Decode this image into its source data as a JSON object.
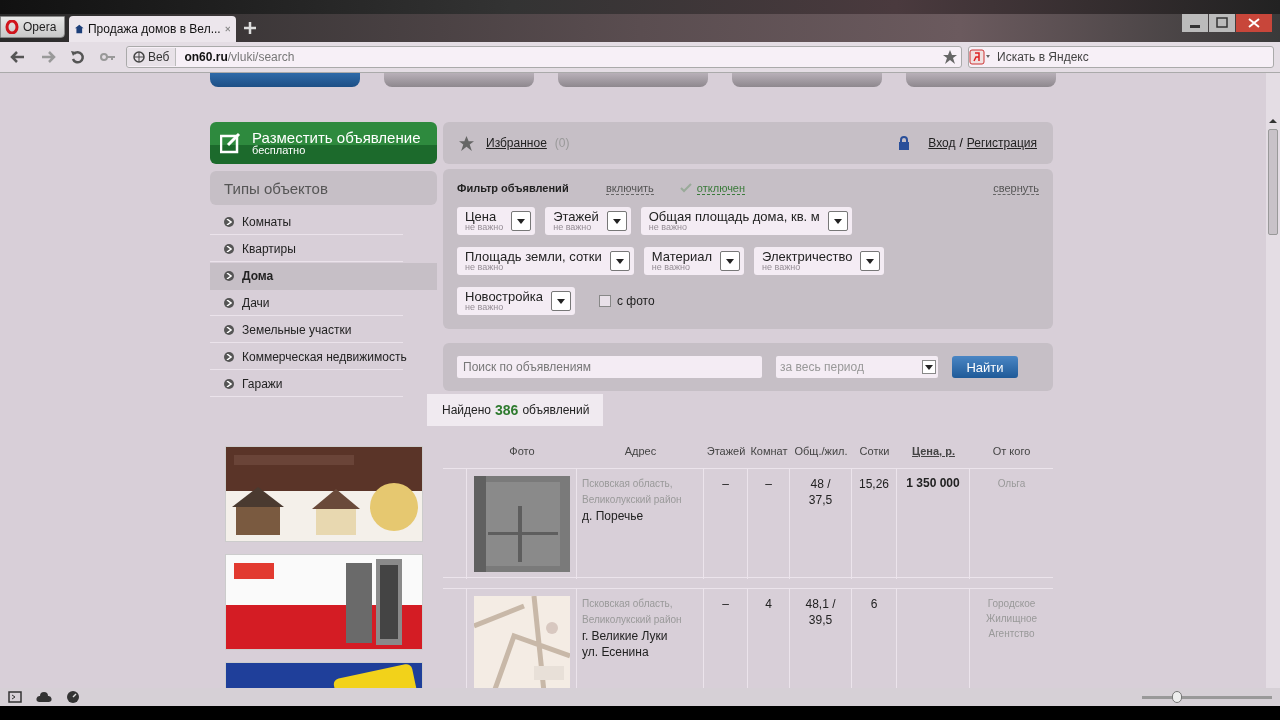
{
  "browser": {
    "menu_button": "Opera",
    "tab": {
      "title": "Продажа домов в Вел...",
      "selected": true
    },
    "address": {
      "web_badge": "Веб",
      "domain": "on60.ru",
      "path": "/vluki/search"
    },
    "search": {
      "placeholder": "Искать в Яндекс"
    },
    "zoom_slider": {
      "level": 0.27
    }
  },
  "post_button": {
    "title": "Разместить объявление",
    "subtitle": "бесплатно"
  },
  "sidebar": {
    "title": "Типы объектов",
    "items": [
      {
        "label": "Комнаты",
        "selected": false
      },
      {
        "label": "Квартиры",
        "selected": false
      },
      {
        "label": "Дома",
        "selected": true
      },
      {
        "label": "Дачи",
        "selected": false
      },
      {
        "label": "Земельные участки",
        "selected": false
      },
      {
        "label": "Коммерческая недвижимость",
        "selected": false
      },
      {
        "label": "Гаражи",
        "selected": false
      }
    ],
    "banners": [
      {
        "kind": "picture"
      },
      {
        "kind": "picture"
      },
      {
        "kind": "picture"
      }
    ]
  },
  "user_bar": {
    "favorites": "Избранное",
    "favorites_count": "(0)",
    "login": "Вход",
    "separator": "/",
    "register": "Регистрация"
  },
  "filter": {
    "title": "Фильтр объявлений",
    "enable": "включить",
    "status": "отключен",
    "collapse": "свернуть",
    "rows": [
      {
        "dropdowns": [
          {
            "label": "Цена",
            "hint": "не важно"
          },
          {
            "label": "Этажей",
            "hint": "не важно"
          },
          {
            "label": "Общая площадь дома, кв. м",
            "hint": "не важно"
          }
        ]
      },
      {
        "dropdowns": [
          {
            "label": "Площадь земли, сотки",
            "hint": "не важно"
          },
          {
            "label": "Материал",
            "hint": "не важно"
          },
          {
            "label": "Электричество",
            "hint": "не важно"
          }
        ]
      },
      {
        "dropdowns": [
          {
            "label": "Новостройка",
            "hint": "не важно"
          }
        ]
      }
    ],
    "photo_checkbox": {
      "label": "с фото",
      "checked": false
    }
  },
  "search": {
    "placeholder": "Поиск по объявлениям",
    "period": "за весь период",
    "button": "Найти"
  },
  "found": {
    "prefix": "Найдено",
    "count": "386",
    "suffix": "объявлений"
  },
  "table": {
    "columns": [
      "Фото",
      "Адрес",
      "Этажей",
      "Комнат",
      "Общ./жил.",
      "Сотки",
      "Цена, р.",
      "От кого"
    ],
    "rows": [
      {
        "photo": {
          "kind": "picture"
        },
        "region": "Псковская область, Великолукский район",
        "locality": [
          "д. Поречье"
        ],
        "floors": "–",
        "rooms": "–",
        "area": "48 / 37,5",
        "sotki": "15,26",
        "price": "1 350 000",
        "seller": "Ольга"
      },
      {
        "photo": {
          "kind": "picture"
        },
        "region": "Псковская область, Великолукский район",
        "locality": [
          "г. Великие Луки",
          "ул. Есенина"
        ],
        "floors": "–",
        "rooms": "4",
        "area": "48,1 / 39,5",
        "sotki": "6",
        "price": "",
        "seller": "Городское Жилищное Агентство"
      }
    ]
  }
}
